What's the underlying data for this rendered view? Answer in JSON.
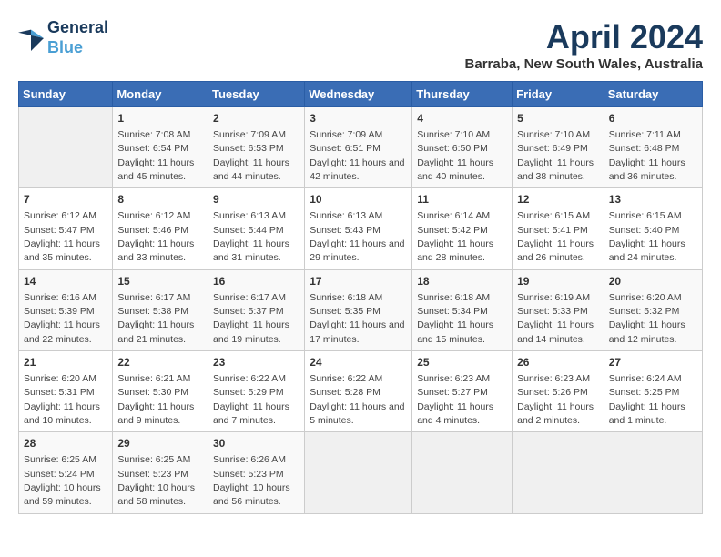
{
  "logo": {
    "line1": "General",
    "line2": "Blue"
  },
  "title": "April 2024",
  "subtitle": "Barraba, New South Wales, Australia",
  "days_of_week": [
    "Sunday",
    "Monday",
    "Tuesday",
    "Wednesday",
    "Thursday",
    "Friday",
    "Saturday"
  ],
  "weeks": [
    [
      {
        "day": "",
        "sunrise": "",
        "sunset": "",
        "daylight": ""
      },
      {
        "day": "1",
        "sunrise": "Sunrise: 7:08 AM",
        "sunset": "Sunset: 6:54 PM",
        "daylight": "Daylight: 11 hours and 45 minutes."
      },
      {
        "day": "2",
        "sunrise": "Sunrise: 7:09 AM",
        "sunset": "Sunset: 6:53 PM",
        "daylight": "Daylight: 11 hours and 44 minutes."
      },
      {
        "day": "3",
        "sunrise": "Sunrise: 7:09 AM",
        "sunset": "Sunset: 6:51 PM",
        "daylight": "Daylight: 11 hours and 42 minutes."
      },
      {
        "day": "4",
        "sunrise": "Sunrise: 7:10 AM",
        "sunset": "Sunset: 6:50 PM",
        "daylight": "Daylight: 11 hours and 40 minutes."
      },
      {
        "day": "5",
        "sunrise": "Sunrise: 7:10 AM",
        "sunset": "Sunset: 6:49 PM",
        "daylight": "Daylight: 11 hours and 38 minutes."
      },
      {
        "day": "6",
        "sunrise": "Sunrise: 7:11 AM",
        "sunset": "Sunset: 6:48 PM",
        "daylight": "Daylight: 11 hours and 36 minutes."
      }
    ],
    [
      {
        "day": "7",
        "sunrise": "Sunrise: 6:12 AM",
        "sunset": "Sunset: 5:47 PM",
        "daylight": "Daylight: 11 hours and 35 minutes."
      },
      {
        "day": "8",
        "sunrise": "Sunrise: 6:12 AM",
        "sunset": "Sunset: 5:46 PM",
        "daylight": "Daylight: 11 hours and 33 minutes."
      },
      {
        "day": "9",
        "sunrise": "Sunrise: 6:13 AM",
        "sunset": "Sunset: 5:44 PM",
        "daylight": "Daylight: 11 hours and 31 minutes."
      },
      {
        "day": "10",
        "sunrise": "Sunrise: 6:13 AM",
        "sunset": "Sunset: 5:43 PM",
        "daylight": "Daylight: 11 hours and 29 minutes."
      },
      {
        "day": "11",
        "sunrise": "Sunrise: 6:14 AM",
        "sunset": "Sunset: 5:42 PM",
        "daylight": "Daylight: 11 hours and 28 minutes."
      },
      {
        "day": "12",
        "sunrise": "Sunrise: 6:15 AM",
        "sunset": "Sunset: 5:41 PM",
        "daylight": "Daylight: 11 hours and 26 minutes."
      },
      {
        "day": "13",
        "sunrise": "Sunrise: 6:15 AM",
        "sunset": "Sunset: 5:40 PM",
        "daylight": "Daylight: 11 hours and 24 minutes."
      }
    ],
    [
      {
        "day": "14",
        "sunrise": "Sunrise: 6:16 AM",
        "sunset": "Sunset: 5:39 PM",
        "daylight": "Daylight: 11 hours and 22 minutes."
      },
      {
        "day": "15",
        "sunrise": "Sunrise: 6:17 AM",
        "sunset": "Sunset: 5:38 PM",
        "daylight": "Daylight: 11 hours and 21 minutes."
      },
      {
        "day": "16",
        "sunrise": "Sunrise: 6:17 AM",
        "sunset": "Sunset: 5:37 PM",
        "daylight": "Daylight: 11 hours and 19 minutes."
      },
      {
        "day": "17",
        "sunrise": "Sunrise: 6:18 AM",
        "sunset": "Sunset: 5:35 PM",
        "daylight": "Daylight: 11 hours and 17 minutes."
      },
      {
        "day": "18",
        "sunrise": "Sunrise: 6:18 AM",
        "sunset": "Sunset: 5:34 PM",
        "daylight": "Daylight: 11 hours and 15 minutes."
      },
      {
        "day": "19",
        "sunrise": "Sunrise: 6:19 AM",
        "sunset": "Sunset: 5:33 PM",
        "daylight": "Daylight: 11 hours and 14 minutes."
      },
      {
        "day": "20",
        "sunrise": "Sunrise: 6:20 AM",
        "sunset": "Sunset: 5:32 PM",
        "daylight": "Daylight: 11 hours and 12 minutes."
      }
    ],
    [
      {
        "day": "21",
        "sunrise": "Sunrise: 6:20 AM",
        "sunset": "Sunset: 5:31 PM",
        "daylight": "Daylight: 11 hours and 10 minutes."
      },
      {
        "day": "22",
        "sunrise": "Sunrise: 6:21 AM",
        "sunset": "Sunset: 5:30 PM",
        "daylight": "Daylight: 11 hours and 9 minutes."
      },
      {
        "day": "23",
        "sunrise": "Sunrise: 6:22 AM",
        "sunset": "Sunset: 5:29 PM",
        "daylight": "Daylight: 11 hours and 7 minutes."
      },
      {
        "day": "24",
        "sunrise": "Sunrise: 6:22 AM",
        "sunset": "Sunset: 5:28 PM",
        "daylight": "Daylight: 11 hours and 5 minutes."
      },
      {
        "day": "25",
        "sunrise": "Sunrise: 6:23 AM",
        "sunset": "Sunset: 5:27 PM",
        "daylight": "Daylight: 11 hours and 4 minutes."
      },
      {
        "day": "26",
        "sunrise": "Sunrise: 6:23 AM",
        "sunset": "Sunset: 5:26 PM",
        "daylight": "Daylight: 11 hours and 2 minutes."
      },
      {
        "day": "27",
        "sunrise": "Sunrise: 6:24 AM",
        "sunset": "Sunset: 5:25 PM",
        "daylight": "Daylight: 11 hours and 1 minute."
      }
    ],
    [
      {
        "day": "28",
        "sunrise": "Sunrise: 6:25 AM",
        "sunset": "Sunset: 5:24 PM",
        "daylight": "Daylight: 10 hours and 59 minutes."
      },
      {
        "day": "29",
        "sunrise": "Sunrise: 6:25 AM",
        "sunset": "Sunset: 5:23 PM",
        "daylight": "Daylight: 10 hours and 58 minutes."
      },
      {
        "day": "30",
        "sunrise": "Sunrise: 6:26 AM",
        "sunset": "Sunset: 5:23 PM",
        "daylight": "Daylight: 10 hours and 56 minutes."
      },
      {
        "day": "",
        "sunrise": "",
        "sunset": "",
        "daylight": ""
      },
      {
        "day": "",
        "sunrise": "",
        "sunset": "",
        "daylight": ""
      },
      {
        "day": "",
        "sunrise": "",
        "sunset": "",
        "daylight": ""
      },
      {
        "day": "",
        "sunrise": "",
        "sunset": "",
        "daylight": ""
      }
    ]
  ]
}
